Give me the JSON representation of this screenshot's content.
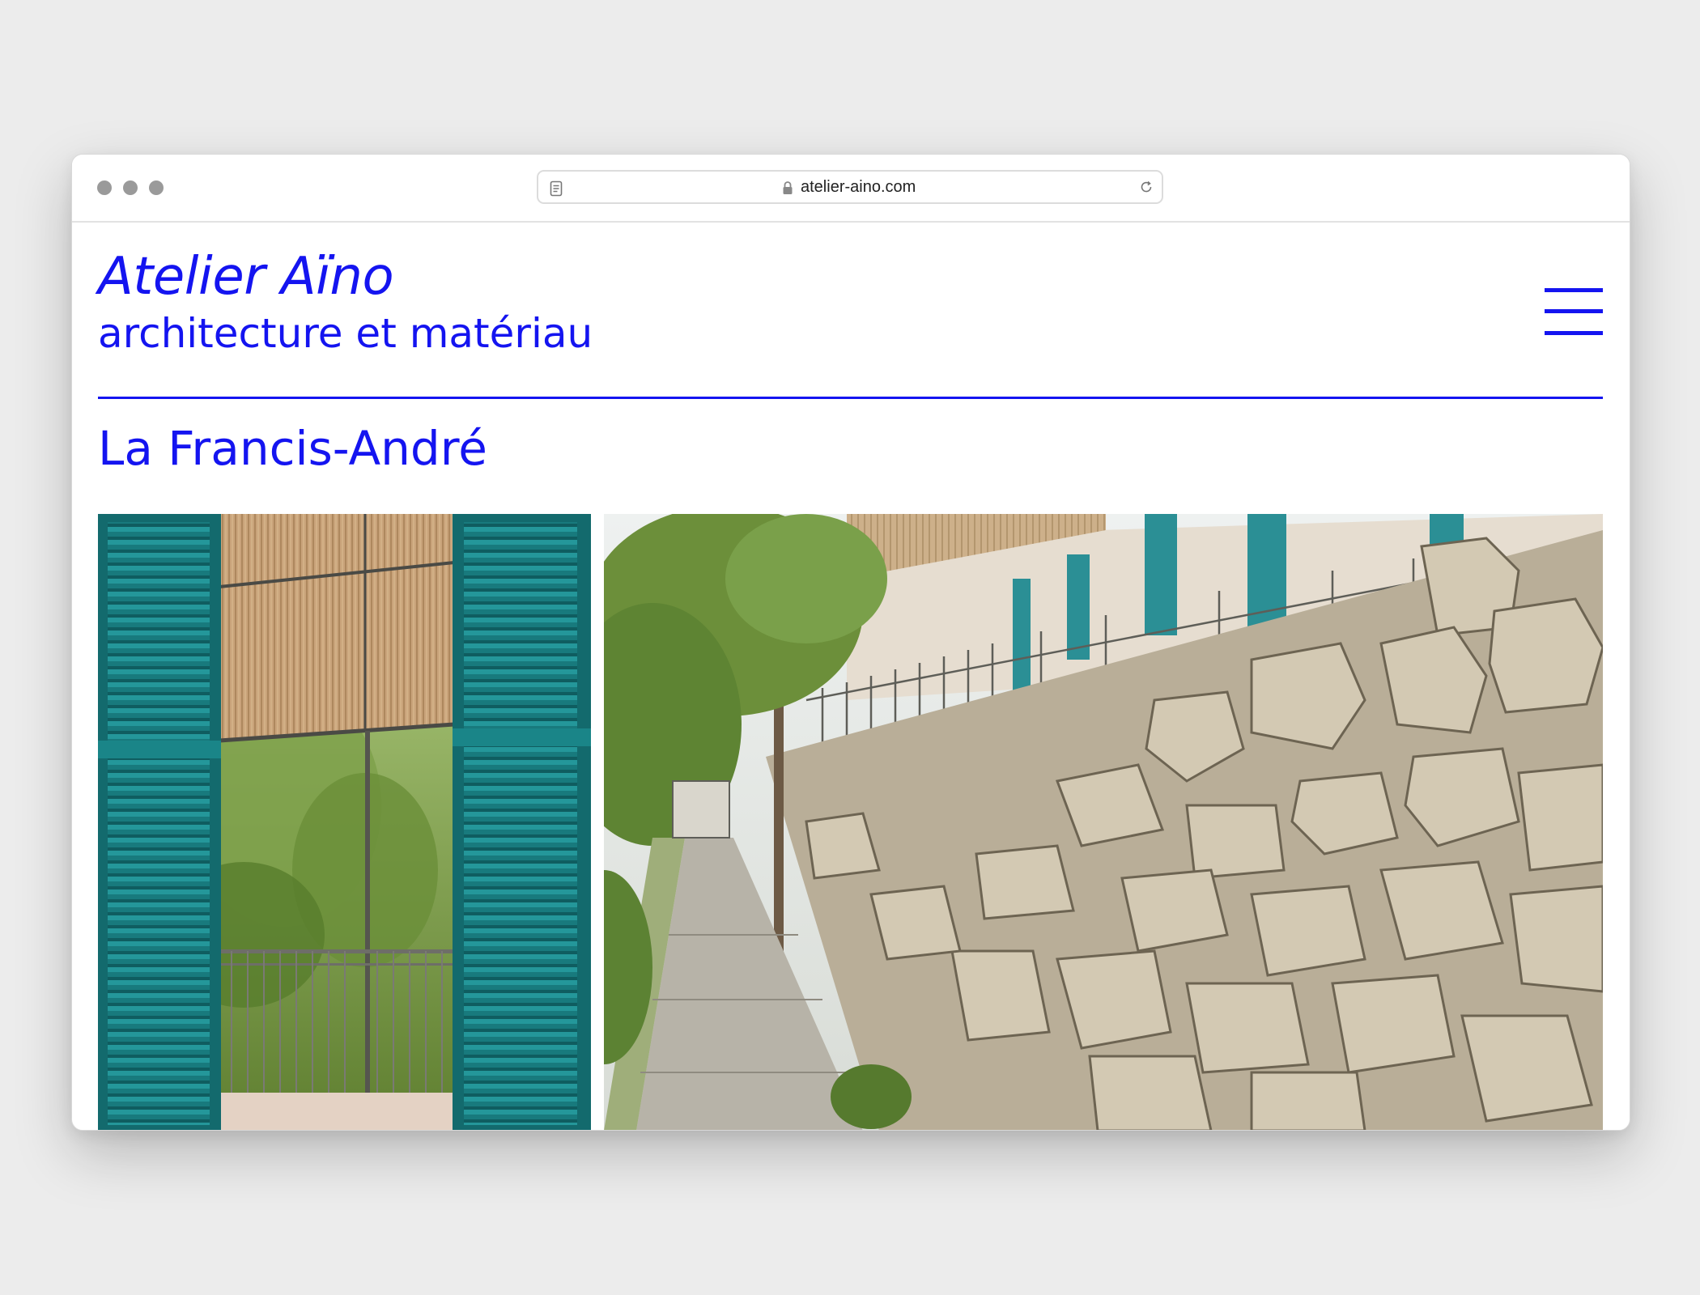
{
  "browser": {
    "url": "atelier-aino.com",
    "colors": {
      "chrome_bg": "#ffffff",
      "traffic_dot": "#9a9a9a"
    }
  },
  "site": {
    "name": "Atelier Aïno",
    "tagline": "architecture et matériau",
    "accent_color": "#1414f0",
    "menu_icon": "hamburger-menu-icon"
  },
  "project": {
    "title": "La Francis-André",
    "images": [
      {
        "name": "balcony-with-teal-shutters-photo",
        "palette": [
          "#1a7f82",
          "#c9a37a",
          "#6f8f3a"
        ]
      },
      {
        "name": "stone-wall-garden-path-photo",
        "palette": [
          "#c7bda8",
          "#8b7f6b",
          "#5a7a35"
        ]
      }
    ]
  }
}
